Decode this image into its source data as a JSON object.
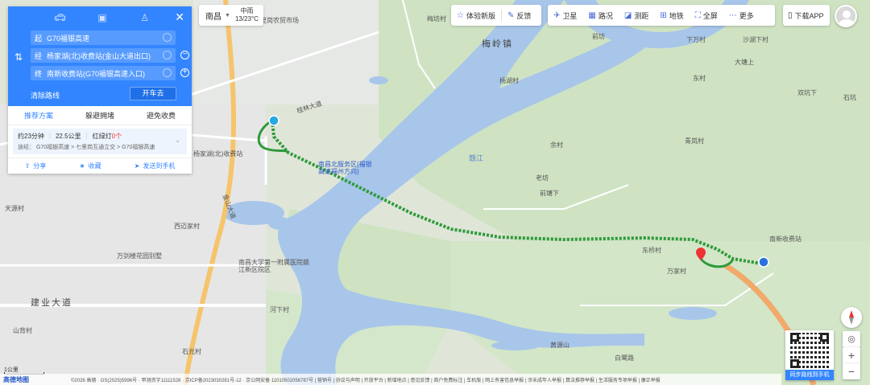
{
  "topbar": {
    "city": "南昌",
    "weather_line1": "中雨",
    "weather_line2": "13/23°C",
    "tools": [
      {
        "icon": "star-icon",
        "label": "体验新版"
      },
      {
        "icon": "feedback-icon",
        "label": "反馈"
      },
      {
        "icon": "satellite-icon",
        "label": "卫星"
      },
      {
        "icon": "traffic-icon",
        "label": "路况"
      },
      {
        "icon": "ruler-icon",
        "label": "测距"
      },
      {
        "icon": "subway-icon",
        "label": "地铁"
      },
      {
        "icon": "fullscreen-icon",
        "label": "全屏"
      },
      {
        "icon": "more-icon",
        "label": "更多"
      }
    ],
    "download_app": "下载APP"
  },
  "route_panel": {
    "waypoints": [
      {
        "tag": "起",
        "text": "G70福银高速"
      },
      {
        "tag": "经",
        "text": "杨家湖(北)收费站(金山大道出口)"
      },
      {
        "tag": "终",
        "text": "南新收费站(G70福银高速入口)"
      }
    ],
    "clear_route": "清除路线",
    "go_button": "开车去",
    "tabs": [
      "推荐方案",
      "躲避拥堵",
      "避免收费"
    ],
    "summary": {
      "time": "约23分钟",
      "distance": "22.5公里",
      "lights_label": "红绿灯",
      "lights_count": "0个",
      "via": "途经：  G70福银高速 > 七里岗互通立交 > G70福银高速"
    },
    "actions": [
      "分享",
      "收藏",
      "发送到手机"
    ]
  },
  "map_labels": [
    {
      "text": "七里岗农贸市场"
    },
    {
      "text": "梅坊村"
    },
    {
      "text": "梅岭镇"
    },
    {
      "text": "前坊"
    },
    {
      "text": "下万村"
    },
    {
      "text": "沙湖下村"
    },
    {
      "text": "大塘上"
    },
    {
      "text": "东村"
    },
    {
      "text": "双坑下"
    },
    {
      "text": "石坑"
    },
    {
      "text": "杨湖村"
    },
    {
      "text": "前塘下"
    },
    {
      "text": "青岚村"
    },
    {
      "text": "余村"
    },
    {
      "text": "老坊"
    },
    {
      "text": "南新收费站"
    },
    {
      "text": "万家村"
    },
    {
      "text": "东桥村"
    },
    {
      "text": "黄源山"
    },
    {
      "text": "白鹭路"
    },
    {
      "text": "天源村"
    },
    {
      "text": "西迈家村"
    },
    {
      "text": "万剑楼花园别墅"
    },
    {
      "text": "南昌大学第一附属医院赣江新区院区"
    },
    {
      "text": "建业大道"
    },
    {
      "text": "河下村"
    },
    {
      "text": "金山大道"
    },
    {
      "text": "南昌北服务区(福银高速福州方向)"
    },
    {
      "text": "赣江"
    },
    {
      "text": "杨家湖(北)收费站"
    },
    {
      "text": "桂林大道"
    },
    {
      "text": "山背村"
    },
    {
      "text": "石光村"
    }
  ],
  "qr_label": "同步路线到手机",
  "scale": "1公里",
  "logo": "高德地图",
  "footer": "©2026 高德 · GS(2025)5996号 · 甲测资字11111528 · 京ICP备2023030281号-12 · 京公网安备 11010502056787号 | 营销号 | 协议与声明 | 开放平台 | 新增地点 | 意见反馈 | 商户免费标注 | 车机版 | 网上有害信息举报 | 涉未成年人举报 | 算法推荐举报 | 生活服务专项举报 | 廉正举报"
}
